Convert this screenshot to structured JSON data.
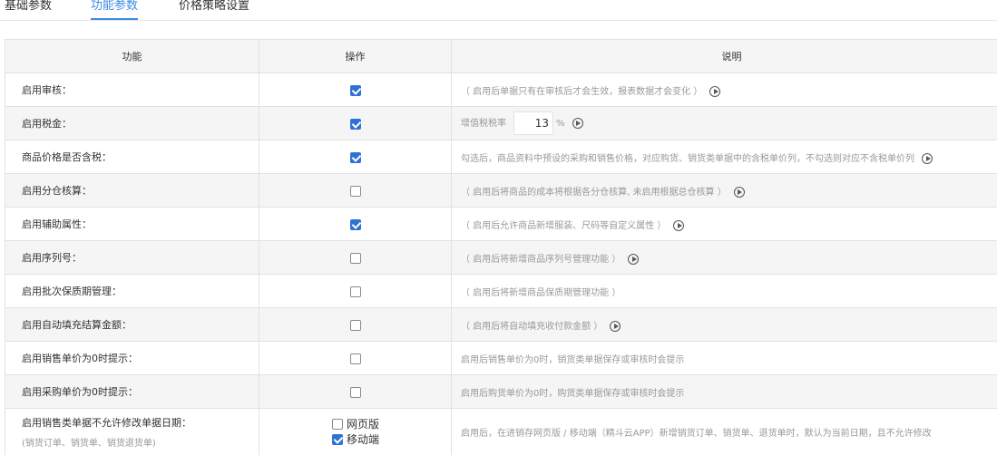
{
  "tabs": [
    {
      "label": "基础参数",
      "active": false
    },
    {
      "label": "功能参数",
      "active": true
    },
    {
      "label": "价格策略设置",
      "active": false
    }
  ],
  "table": {
    "headers": {
      "function": "功能",
      "operation": "操作",
      "description": "说明"
    },
    "rows": [
      {
        "label": "启用审核：",
        "checked": true,
        "desc": "（ 启用后单据只有在审核后才会生效，报表数据才会变化 ）",
        "info": true
      },
      {
        "label": "启用税金：",
        "checked": true,
        "desc": "增值税税率",
        "rate": "13",
        "rate_unit": "%",
        "info": true
      },
      {
        "label": "商品价格是否含税：",
        "checked": true,
        "desc": "勾选后，商品资料中预设的采购和销售价格，对应购货、销货类单据中的含税单价列，不勾选则对应不含税单价列",
        "info": true
      },
      {
        "label": "启用分仓核算：",
        "checked": false,
        "desc": "（ 启用后将商品的成本将根据各分仓核算, 未启用根据总仓核算 ）",
        "info": true
      },
      {
        "label": "启用辅助属性：",
        "checked": true,
        "desc": "（ 启用后允许商品新增服装、尺码等自定义属性 ）",
        "info": true
      },
      {
        "label": "启用序列号：",
        "checked": false,
        "desc": "（ 启用后将新增商品序列号管理功能 ）",
        "info": true
      },
      {
        "label": "启用批次保质期管理：",
        "checked": false,
        "desc": "（ 启用后将新增商品保质期管理功能 ）",
        "info": false
      },
      {
        "label": "启用自动填充结算金额：",
        "checked": false,
        "desc": "（ 启用后将自动填充收付款金额 ）",
        "info": true
      },
      {
        "label": "启用销售单价为0时提示：",
        "checked": false,
        "desc": "启用后销售单价为0时，销货类单据保存或审核时会提示",
        "info": false
      },
      {
        "label": "启用采购单价为0时提示：",
        "checked": false,
        "desc": "启用后购货单价为0时，购货类单据保存或审核时会提示",
        "info": false
      }
    ],
    "last_row": {
      "label": "启用销售类单据不允许修改单据日期：",
      "sublabel": "(销货订单、销货单、销货退货单)",
      "options": [
        {
          "label": "网页版",
          "checked": false
        },
        {
          "label": "移动端",
          "checked": true
        }
      ],
      "desc": "启用后，在进销存网页版 / 移动端（精斗云APP）新增销货订单、销货单、退货单时，默认为当前日期，且不允许修改"
    }
  },
  "colors": {
    "accent": "#3d8be6",
    "checkbox": "#2f72d6",
    "border": "#e2e2e2",
    "stripe": "#f5f5f5",
    "muted": "#999999"
  }
}
